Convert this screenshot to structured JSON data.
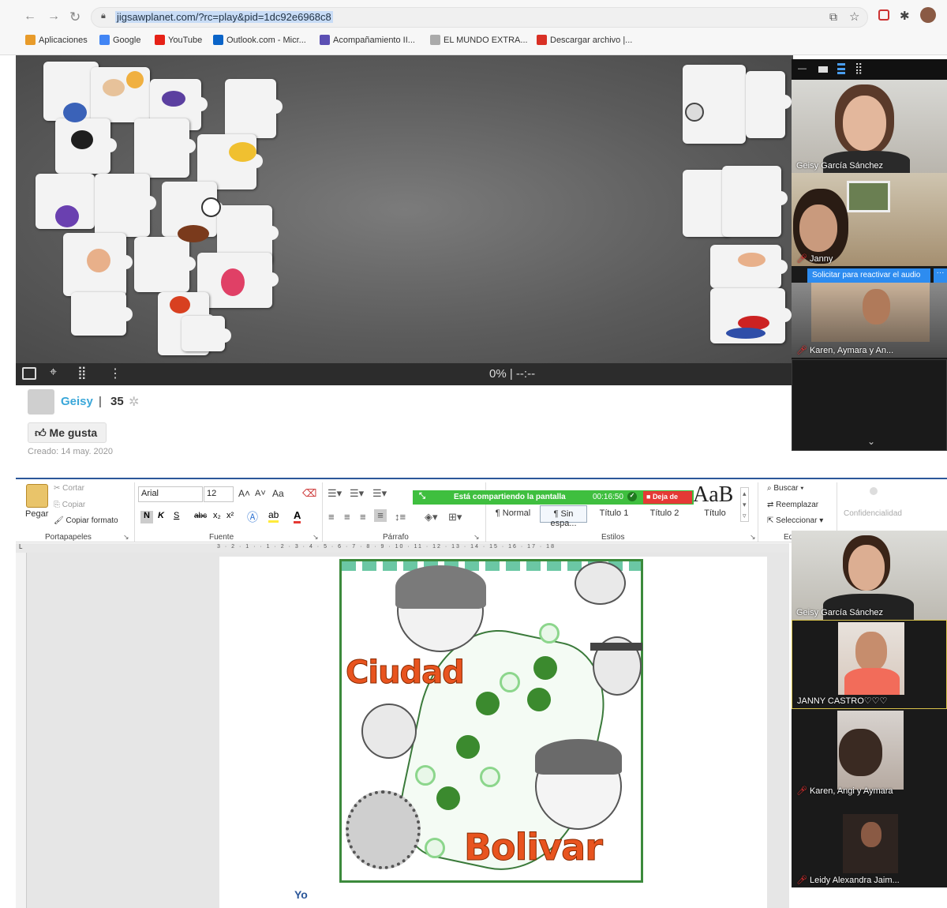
{
  "browser": {
    "url": "jigsawplanet.com/?rc=play&pid=1dc92e6968c8",
    "bookmarks": [
      {
        "label": "Aplicaciones",
        "icon": "apps-grid-icon",
        "color": "#e89b2a"
      },
      {
        "label": "Google",
        "icon": "google-icon",
        "color": "#4285f4"
      },
      {
        "label": "YouTube",
        "icon": "youtube-icon",
        "color": "#e62117"
      },
      {
        "label": "Outlook.com - Micr...",
        "icon": "outlook-icon",
        "color": "#0a64c8"
      },
      {
        "label": "Acompañamiento II...",
        "icon": "doc-icon",
        "color": "#5b4fb3"
      },
      {
        "label": "EL MUNDO EXTRA...",
        "icon": "page-icon",
        "color": "#aaaaaa"
      },
      {
        "label": "Descargar archivo |...",
        "icon": "download-icon",
        "color": "#d93025"
      }
    ]
  },
  "puzzle": {
    "progress": "0% | --:--"
  },
  "user": {
    "name": "Geisy",
    "separator": "|",
    "score": "35",
    "like_label": "Me gusta",
    "created": "Creado: 14 may. 2020"
  },
  "zoom_top": {
    "participants": [
      {
        "name": "Geisy García Sánchez",
        "muted": false
      },
      {
        "name": "Janny",
        "muted": true
      },
      {
        "name": "Karen, Aymara y An...",
        "muted": true
      }
    ],
    "audio_request": "Solicitar para reactivar el audio"
  },
  "word": {
    "clipboard": {
      "paste": "Pegar",
      "cut": "Cortar",
      "copy": "Copiar",
      "format": "Copiar formato",
      "group": "Portapapeles"
    },
    "font": {
      "name": "Arial",
      "size": "12",
      "group": "Fuente",
      "bold": "N",
      "italic": "K",
      "underline": "S",
      "strike": "abc",
      "sub": "x₂",
      "sup": "x²",
      "case": "Aa"
    },
    "paragraph": {
      "group": "Párrafo"
    },
    "styles": {
      "group": "Estilos",
      "items": [
        "¶ Normal",
        "¶ Sin espa...",
        "Título 1",
        "Título 2",
        "Título"
      ],
      "preview": "AaB"
    },
    "editing": {
      "find": "Buscar",
      "replace": "Reemplazar",
      "select": "Seleccionar",
      "group": "Ed"
    },
    "confidential": "Confidencialidad",
    "share_bar": {
      "text": "Está compartiendo la pantalla",
      "time": "00:16:50",
      "stop": "Deja de"
    },
    "ruler": "3 · 2 · 1 · · 1 · 2 · 3 · 4 · 5 · 6 · 7 · 8 · 9 · 10 · 11 · 12 · 13 · 14 · 15 · 16 · 17 · 18",
    "art": {
      "word1": "Ciudad",
      "word2": "Bolivar"
    },
    "caption": "Yo"
  },
  "zoom_bottom": {
    "participants": [
      {
        "name": "Geisy García Sánchez",
        "muted": false
      },
      {
        "name": "JANNY CASTRO♡♡♡",
        "muted": false
      },
      {
        "name": "Karen, Angi y Aymara",
        "muted": true
      },
      {
        "name": "Leidy Alexandra Jaim...",
        "muted": true
      }
    ]
  }
}
